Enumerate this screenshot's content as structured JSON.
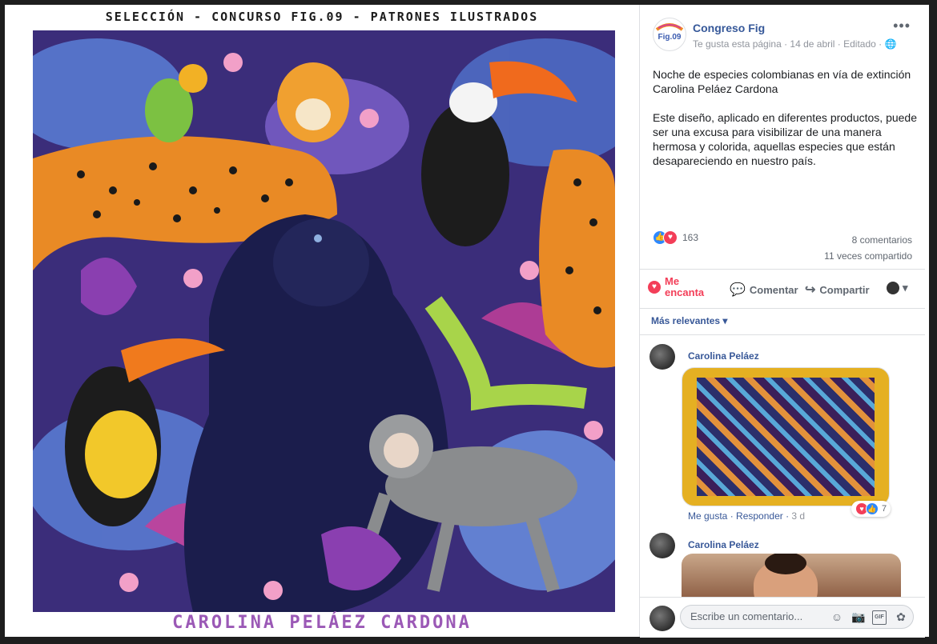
{
  "artwork": {
    "title": "SELECCIÓN - CONCURSO FIG.09 - PATRONES ILUSTRADOS",
    "author": "CAROLINA PELÁEZ CARDONA"
  },
  "post": {
    "page_name": "Congreso Fig",
    "meta": "Te gusta esta página · 14 de abril · Editado · ",
    "avatar_text": "Fig.09",
    "paragraph1": "Noche de especies colombianas en vía de extinción Carolina Peláez Cardona",
    "paragraph2": "Este diseño, aplicado en diferentes productos, puede ser una excusa para visibilizar de una manera hermosa y colorida, aquellas especies que están desapareciendo en nuestro país.",
    "reaction_count": "163",
    "comments_count": "8 comentarios",
    "shares_count": "11 veces compartido"
  },
  "actions": {
    "love": "Me encanta",
    "comment": "Comentar",
    "share": "Compartir"
  },
  "comments": {
    "sort_label": "Más relevantes",
    "items": [
      {
        "author": "Carolina Peláez",
        "like": "Me gusta",
        "reply": "Responder",
        "time": "3 d",
        "reactions": "7"
      },
      {
        "author": "Carolina Peláez"
      }
    ],
    "composer_placeholder": "Escribe un comentario..."
  },
  "colors": {
    "link": "#365899",
    "love": "#f33e58",
    "like": "#2d88ff",
    "author_purple": "#9b59b6"
  }
}
